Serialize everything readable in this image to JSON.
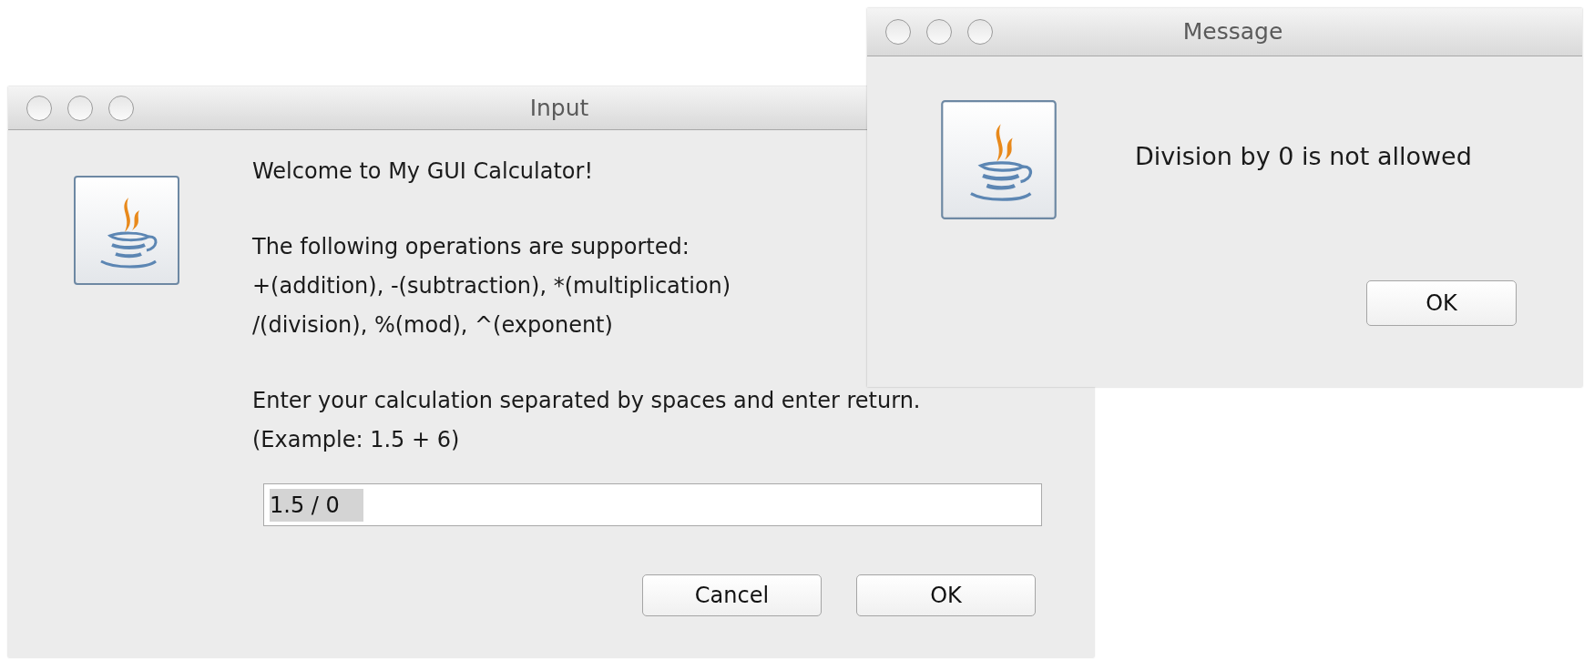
{
  "windows": [
    {
      "kind": "input",
      "title": "Input",
      "paragraphs": [
        [
          "Welcome to My GUI Calculator!"
        ],
        [
          "The following operations are supported:",
          "+(addition), -(subtraction), *(multiplication)",
          "/(division), %(mod), ^(exponent)"
        ],
        [
          "Enter your calculation separated by spaces and enter return.",
          "(Example: 1.5 + 6)"
        ]
      ],
      "field": {
        "value": "1.5 / 0",
        "text_selected": true
      },
      "buttons": [
        "Cancel",
        "OK"
      ]
    },
    {
      "kind": "message",
      "title": "Message",
      "paragraphs": [
        [
          "Division by 0 is not allowed"
        ]
      ],
      "buttons": [
        "OK"
      ]
    }
  ]
}
